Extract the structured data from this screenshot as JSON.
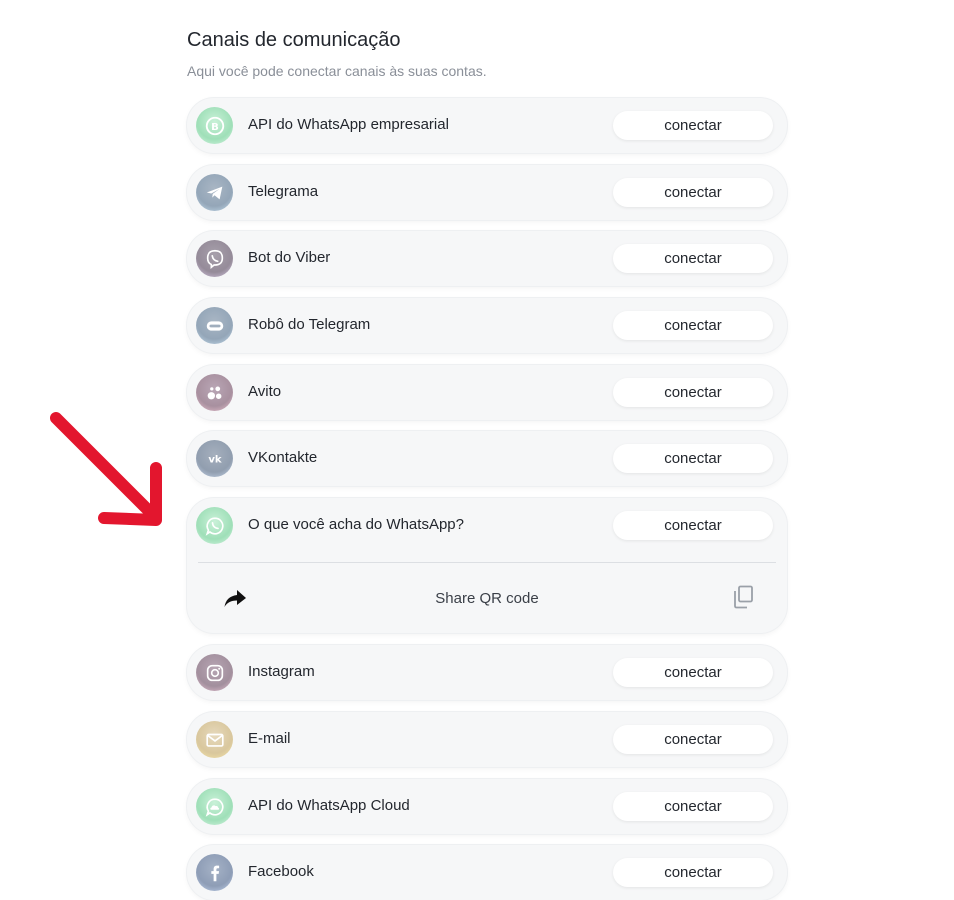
{
  "header": {
    "title": "Canais de comunicação",
    "subtitle": "Aqui você pode conectar canais às suas contas."
  },
  "connect_label": "conectar",
  "channels": [
    {
      "name": "API do WhatsApp empresarial",
      "icon": "whatsapp-business-icon"
    },
    {
      "name": "Telegrama",
      "icon": "telegram-icon"
    },
    {
      "name": "Bot do Viber",
      "icon": "viber-icon"
    },
    {
      "name": "Robô do Telegram",
      "icon": "telegram-bot-icon"
    },
    {
      "name": "Avito",
      "icon": "avito-icon"
    },
    {
      "name": "VKontakte",
      "icon": "vk-icon"
    },
    {
      "name": "O que você acha do WhatsApp?",
      "icon": "whatsapp-icon"
    },
    {
      "name": "Instagram",
      "icon": "instagram-icon"
    },
    {
      "name": "E-mail",
      "icon": "email-icon"
    },
    {
      "name": "API do WhatsApp Cloud",
      "icon": "whatsapp-cloud-icon"
    },
    {
      "name": "Facebook",
      "icon": "facebook-icon"
    }
  ],
  "expanded": {
    "share_label": "Share QR code"
  },
  "colors": {
    "row_bg": "#f6f7f8",
    "annotation_arrow": "#e3162e",
    "whatsapp": "#25d366",
    "telegram": "#2aa1da",
    "viber": "#7360f2",
    "avito": "#a55ba5",
    "vk": "#4a76a8",
    "instagram": "#c13584",
    "email": "#f2b705",
    "facebook": "#1877f2"
  }
}
